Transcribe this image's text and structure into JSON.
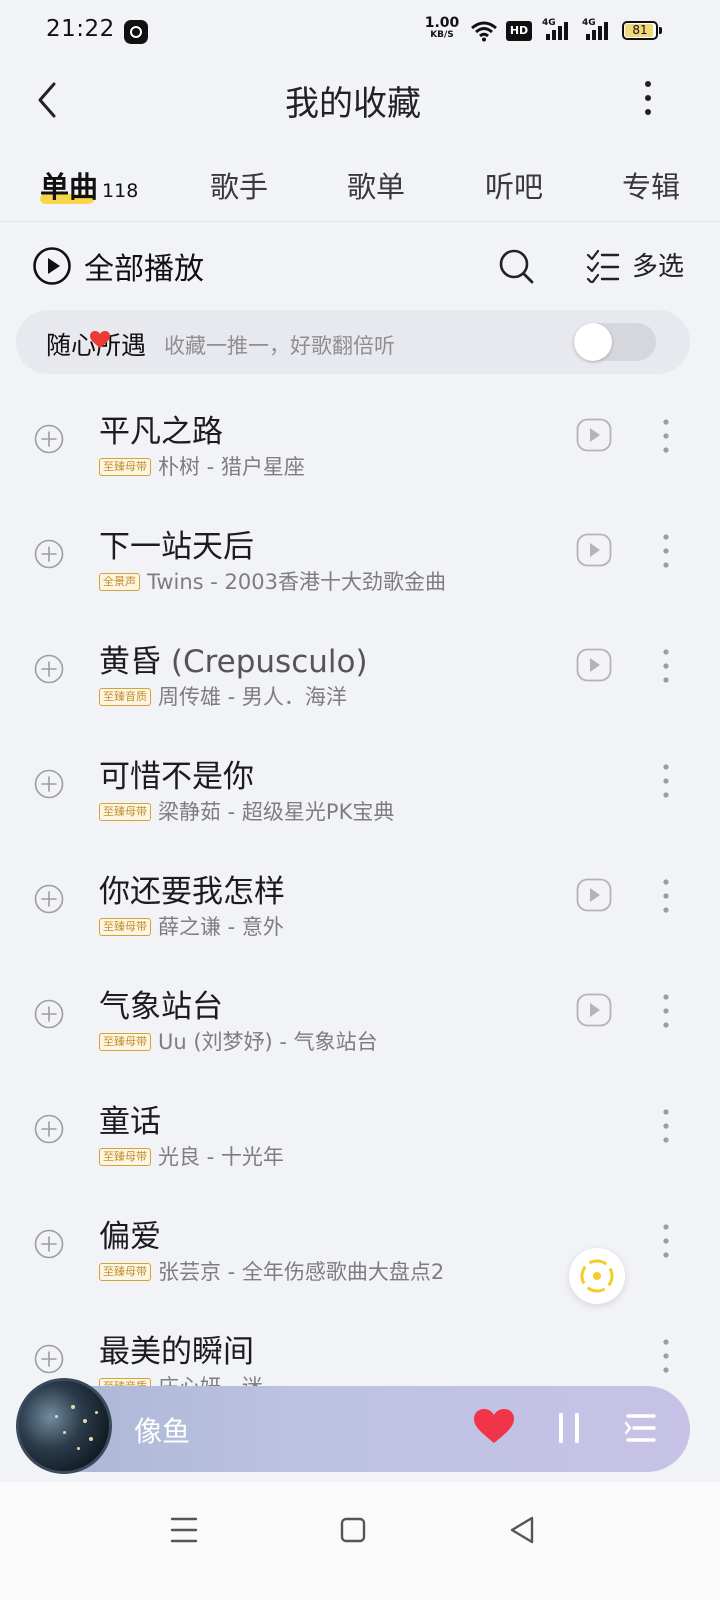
{
  "status_bar": {
    "time": "21:22",
    "net_speed_value": "1.00",
    "net_speed_unit": "KB/S",
    "hd_label": "HD",
    "signal_1_label": "4G",
    "signal_2_label": "4G",
    "battery": "81",
    "battery_color": "#f1d97a"
  },
  "header": {
    "title": "我的收藏",
    "back_icon": "chevron-left-icon",
    "more_icon": "more-vertical-icon"
  },
  "tabs": [
    {
      "label": "单曲",
      "count": "118",
      "active": true
    },
    {
      "label": "歌手"
    },
    {
      "label": "歌单"
    },
    {
      "label": "听吧"
    },
    {
      "label": "专辑"
    }
  ],
  "toolbar": {
    "play_all_label": "全部播放",
    "multi_select_label": "多选",
    "search_icon": "search-icon"
  },
  "random_card": {
    "title": "随心所遇",
    "subtitle": "收藏一推一，好歌翻倍听",
    "toggle_on": false
  },
  "songs": [
    {
      "title": "平凡之路",
      "badge": "至臻母带",
      "subtitle": "朴树 - 猎户星座",
      "has_mv": true
    },
    {
      "title": "下一站天后",
      "badge": "全景声",
      "subtitle": "Twins - 2003香港十大劲歌金曲",
      "has_mv": true
    },
    {
      "title": "黄昏",
      "title_latin": "(Crepusculo)",
      "badge": "至臻音质",
      "subtitle": "周传雄 - 男人．海洋",
      "has_mv": true
    },
    {
      "title": "可惜不是你",
      "badge": "至臻母带",
      "subtitle": "梁静茹 - 超级星光PK宝典",
      "has_mv": false
    },
    {
      "title": "你还要我怎样",
      "badge": "至臻母带",
      "subtitle": "薛之谦 - 意外",
      "has_mv": true
    },
    {
      "title": "气象站台",
      "badge": "至臻母带",
      "subtitle": "Uu (刘梦妤) - 气象站台",
      "has_mv": true
    },
    {
      "title": "童话",
      "badge": "至臻母带",
      "subtitle": "光良 - 十光年",
      "has_mv": false
    },
    {
      "title": "偏爱",
      "badge": "至臻母带",
      "subtitle": "张芸京 - 全年伤感歌曲大盘点2",
      "has_mv": false
    },
    {
      "title": "最美的瞬间",
      "badge": "至臻音质",
      "subtitle": "庄心妍 - 迷",
      "has_mv": false
    }
  ],
  "mini_player": {
    "title": "像鱼",
    "liked": true,
    "accent_heart": "#f0344a"
  },
  "colors": {
    "tab_underline": "#f7d64a",
    "badge_gold": "#c0912d",
    "background": "#f2f3f7"
  }
}
